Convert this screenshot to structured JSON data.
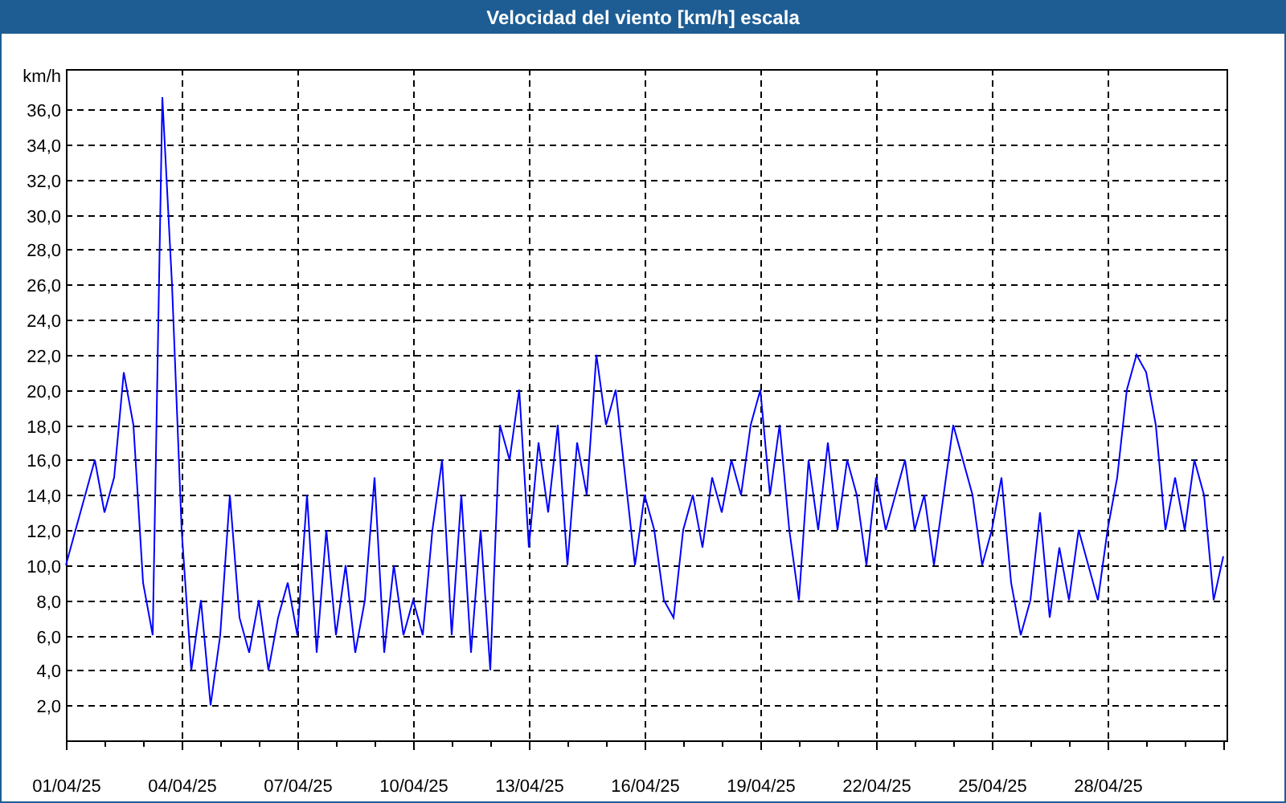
{
  "window": {
    "title": "Velocidad del viento [km/h] escala"
  },
  "chart_data": {
    "type": "line",
    "ylabel": "km/h",
    "grid": true,
    "ylim": [
      0,
      38.3
    ],
    "yticks": [
      {
        "value": 2,
        "label": "2,0"
      },
      {
        "value": 4,
        "label": "4,0"
      },
      {
        "value": 6,
        "label": "6,0"
      },
      {
        "value": 8,
        "label": "8,0"
      },
      {
        "value": 10,
        "label": "10,0"
      },
      {
        "value": 12,
        "label": "12,0"
      },
      {
        "value": 14,
        "label": "14,0"
      },
      {
        "value": 16,
        "label": "16,0"
      },
      {
        "value": 18,
        "label": "18,0"
      },
      {
        "value": 20,
        "label": "20,0"
      },
      {
        "value": 22,
        "label": "22,0"
      },
      {
        "value": 24,
        "label": "24,0"
      },
      {
        "value": 26,
        "label": "26,0"
      },
      {
        "value": 28,
        "label": "28,0"
      },
      {
        "value": 30,
        "label": "30,0"
      },
      {
        "value": 32,
        "label": "32,0"
      },
      {
        "value": 34,
        "label": "34,0"
      },
      {
        "value": 36,
        "label": "36,0"
      }
    ],
    "categories": [
      "01/04/25",
      null,
      null,
      null,
      null,
      null,
      null,
      null,
      null,
      null,
      null,
      null,
      "04/04/25",
      null,
      null,
      null,
      null,
      null,
      null,
      null,
      null,
      null,
      null,
      null,
      "07/04/25",
      null,
      null,
      null,
      null,
      null,
      null,
      null,
      null,
      null,
      null,
      null,
      "10/04/25",
      null,
      null,
      null,
      null,
      null,
      null,
      null,
      null,
      null,
      null,
      null,
      "13/04/25",
      null,
      null,
      null,
      null,
      null,
      null,
      null,
      null,
      null,
      null,
      null,
      "16/04/25",
      null,
      null,
      null,
      null,
      null,
      null,
      null,
      null,
      null,
      null,
      null,
      "19/04/25",
      null,
      null,
      null,
      null,
      null,
      null,
      null,
      null,
      null,
      null,
      null,
      "22/04/25",
      null,
      null,
      null,
      null,
      null,
      null,
      null,
      null,
      null,
      null,
      null,
      "25/04/25",
      null,
      null,
      null,
      null,
      null,
      null,
      null,
      null,
      null,
      null,
      null,
      "28/04/25",
      null,
      null,
      null,
      null,
      null,
      null,
      null,
      null,
      null,
      null,
      null,
      null
    ],
    "series": [
      {
        "color": "#0000ff",
        "values": [
          10,
          12,
          14,
          16,
          13,
          15,
          21,
          18,
          9,
          6,
          36.7,
          26,
          12,
          4,
          8,
          2,
          6,
          14,
          7,
          5,
          8,
          4,
          7,
          9,
          6,
          14,
          5,
          12,
          6,
          10,
          5,
          8,
          15,
          5,
          10,
          6,
          8,
          6,
          12,
          16,
          6,
          14,
          5,
          12,
          4,
          18,
          16,
          20,
          11,
          17,
          13,
          18,
          10,
          17,
          14,
          22,
          18,
          20,
          15,
          10,
          14,
          12,
          8,
          7,
          12,
          14,
          11,
          15,
          13,
          16,
          14,
          18,
          20,
          14,
          18,
          12,
          8,
          16,
          12,
          17,
          12,
          16,
          14,
          10,
          15,
          12,
          14,
          16,
          12,
          14,
          10,
          14,
          18,
          16,
          14,
          10,
          12,
          15,
          9,
          6,
          8,
          13,
          7,
          11,
          8,
          12,
          10,
          8,
          12,
          15,
          20,
          22,
          21,
          18,
          12,
          15,
          12,
          16,
          14,
          8,
          10.5
        ]
      }
    ]
  }
}
